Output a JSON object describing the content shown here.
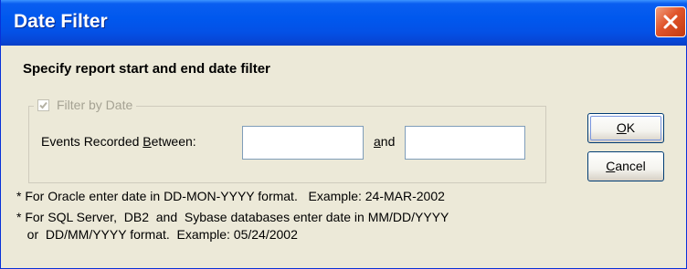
{
  "dialog": {
    "title": "Date Filter",
    "heading": "Specify report start and end date filter"
  },
  "filter_group": {
    "checkbox_label": "Filter by Date",
    "checkbox_checked": true,
    "checkbox_enabled": false,
    "events_label_prefix": "Events Recorded ",
    "events_label_mnemonic": "B",
    "events_label_suffix": "etween:",
    "and_mnemonic": "a",
    "and_suffix": "nd",
    "start_date_value": "",
    "end_date_value": ""
  },
  "buttons": {
    "ok_mnemonic": "O",
    "ok_suffix": "K",
    "cancel_mnemonic": "C",
    "cancel_suffix": "ancel"
  },
  "notes": [
    "* For Oracle enter date in DD-MON-YYYY format.   Example: 24-MAR-2002",
    "* For SQL Server,  DB2  and  Sybase databases enter date in MM/DD/YYYY",
    "   or  DD/MM/YYYY format.  Example: 05/24/2002"
  ],
  "colors": {
    "titlebar": "#0058ee",
    "dialog_background": "#ece9d8",
    "close_button": "#e0542a",
    "disabled_text": "#a5a293"
  }
}
